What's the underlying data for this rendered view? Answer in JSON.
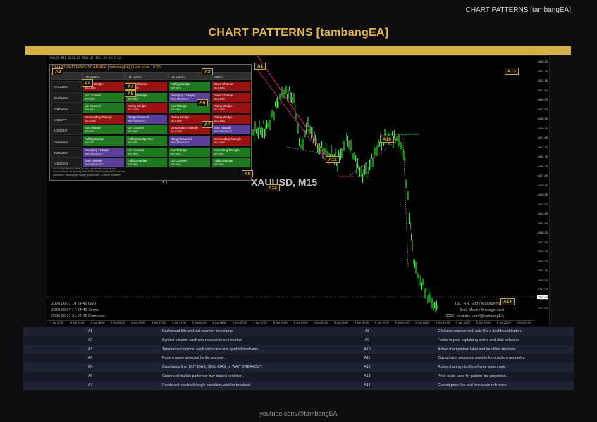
{
  "brand_top": "CHART PATTERNS [tambangEA]",
  "page_title": "CHART PATTERNS [tambangEA]",
  "plot_info": "XAUUSD,M15  4524.29 4530.41 4521.84 4527.03",
  "watermark": "XAUUSD, M15",
  "timestamps": [
    "2026.06.07 14:24:46 GMT",
    "2026.06.07 17:24:48 Server",
    "2026.06.07 21:24:46 Computer"
  ],
  "brand_box": [
    "1SL, RR, Entry Management",
    "2nd, Money Management",
    "2026, youtube.com/@tambangEA"
  ],
  "price_axis": [
    "4540.25",
    "4531.70",
    "4523.15",
    "4514.60",
    "4506.05",
    "4497.50",
    "4488.95",
    "4480.40",
    "4471.85",
    "4463.30",
    "4454.75",
    "4446.20",
    "4437.65",
    "4429.10",
    "4420.55",
    "4412.00",
    "4403.45",
    "4394.90",
    "4386.35",
    "4377.80",
    "4369.25",
    "4360.70",
    "4352.15",
    "4343.60",
    "4335.05",
    "4326.50",
    "4317.95"
  ],
  "current_price": "4327.04",
  "time_axis": [
    "4 Jun 2026",
    "4 Jun 04:00",
    "4 Jun 06:00",
    "4 Jun 08:00",
    "4 Jun 10:00",
    "4 Jun 12:00",
    "4 Jun 14:00",
    "4 Jun 16:00",
    "4 Jun 18:00",
    "4 Jun 20:00",
    "4 Jun 22:00",
    "5 Jun 00:00",
    "5 Jun 02:00",
    "5 Jun 04:00",
    "5 Jun 06:00",
    "5 Jun 08:00",
    "5 Jun 10:00",
    "5 Jun 12:00",
    "5 Jun 14:00",
    "5 Jun 16:00",
    "5 Jun 18:00",
    "5 Jun 20:00",
    "5 Jun 22:00",
    "5 Jun 23:00"
  ],
  "chart_labels": {
    "channel_note": "Ascending Wedge [Last Active]",
    "zigzag_a": "Falling Wedge",
    "zigzag_b": "BUY BIAS"
  },
  "scanner": {
    "title": "CHART PATTERNS SCANNER [tambangEA] | Last scan 15:25",
    "columns": [
      "M5 pattern",
      "H1 pattern",
      "H4 pattern",
      "pattern"
    ],
    "rows": [
      {
        "symbol": "XAUUSD",
        "cells": [
          {
            "name": "Rising Wedge",
            "bias": "SELL BIAS",
            "color": "#9a1212"
          },
          {
            "name": "Down Channel",
            "bias": "SELL BIAS",
            "color": "#9a1212"
          },
          {
            "name": "Falling Wedge",
            "bias": "BUY BIAS",
            "color": "#1f7a1f"
          },
          {
            "name": "Down Channel",
            "bias": "SELL BIAS",
            "color": "#9a1212"
          }
        ]
      },
      {
        "symbol": "EURUSD",
        "cells": [
          {
            "name": "Up Channel",
            "bias": "BUY BIAS",
            "color": "#1f7a1f"
          },
          {
            "name": "Falling Wedge",
            "bias": "BUY BIAS",
            "color": "#1f7a1f"
          },
          {
            "name": "Diverging Triangle",
            "bias": "WAIT BREAKOUT",
            "color": "#5a3f9a"
          },
          {
            "name": "Down Channel",
            "bias": "SELL BIAS",
            "color": "#9a1212"
          }
        ]
      },
      {
        "symbol": "GBPUSD",
        "cells": [
          {
            "name": "Up Channel",
            "bias": "BUY BIAS",
            "color": "#1f7a1f"
          },
          {
            "name": "Rising Wedge",
            "bias": "SELL BIAS",
            "color": "#9a1212"
          },
          {
            "name": "Asc Triangle",
            "bias": "BUY BIAS",
            "color": "#1f7a1f"
          },
          {
            "name": "Rising Wedge",
            "bias": "SELL BIAS",
            "color": "#9a1212"
          }
        ]
      },
      {
        "symbol": "USDJPY",
        "cells": [
          {
            "name": "Descending Triangle",
            "bias": "SELL BIAS",
            "color": "#9a1212"
          },
          {
            "name": "Range Channel",
            "bias": "WAIT BREAKOUT",
            "color": "#5a3f9a"
          },
          {
            "name": "Rising Wedge",
            "bias": "SELL BIAS",
            "color": "#9a1212"
          },
          {
            "name": "Rising Wedge",
            "bias": "SELL BIAS",
            "color": "#9a1212"
          }
        ]
      },
      {
        "symbol": "USDCHF",
        "cells": [
          {
            "name": "Asc Triangle",
            "bias": "BUY BIAS",
            "color": "#1f7a1f"
          },
          {
            "name": "Up Channel",
            "bias": "BUY BIAS",
            "color": "#1f7a1f"
          },
          {
            "name": "Descending Triangle",
            "bias": "SELL BIAS",
            "color": "#9a1212"
          },
          {
            "name": "Sym Triangle",
            "bias": "WAIT BREAKOUT",
            "color": "#5a3f9a"
          }
        ]
      },
      {
        "symbol": "AUDUSD",
        "cells": [
          {
            "name": "Falling Wedge",
            "bias": "BUY BIAS",
            "color": "#1f7a1f"
          },
          {
            "name": "Falling Wedge Rep",
            "bias": "BUY BIAS",
            "color": "#1f7a1f"
          },
          {
            "name": "Range Channel",
            "bias": "WAIT BREAKOUT",
            "color": "#5a3f9a"
          },
          {
            "name": "Descending Triangle",
            "bias": "SELL BIAS",
            "color": "#9a1212"
          }
        ]
      },
      {
        "symbol": "NZDUSD",
        "cells": [
          {
            "name": "Diverging Triangle",
            "bias": "WAIT BREAKOUT",
            "color": "#5a3f9a"
          },
          {
            "name": "Up Channel",
            "bias": "BUY BIAS",
            "color": "#1f7a1f"
          },
          {
            "name": "Asc Triangle",
            "bias": "BUY BIAS",
            "color": "#1f7a1f"
          },
          {
            "name": "Ascending Triangle",
            "bias": "BUY BIAS",
            "color": "#1f7a1f"
          }
        ]
      },
      {
        "symbol": "USDCAD",
        "cells": [
          {
            "name": "Sym Triangle",
            "bias": "WAIT BREAKOUT",
            "color": "#5a3f9a"
          },
          {
            "name": "Falling Wedge",
            "bias": "BUY BIAS",
            "color": "#1f7a1f"
          },
          {
            "name": "Up Channel",
            "bias": "BUY BIAS",
            "color": "#1f7a1f"
          },
          {
            "name": "Falling Wedge",
            "bias": "BUY BIAS",
            "color": "#1f7a1f"
          }
        ]
      }
    ],
    "footer": [
      "Cell format: pattern name on top, signal/bias below it/bias",
      "Colors: Green=BUY bias | Red=SELL bias | Purple=WAIT / neutral",
      "Click cell = switch/open chart | Bold border = current market/tf"
    ]
  },
  "callouts": [
    "A1",
    "A2",
    "A3",
    "A4",
    "A5",
    "A6",
    "A7",
    "A8",
    "A9",
    "A10",
    "A11",
    "A12",
    "A13",
    "A14"
  ],
  "legend": [
    {
      "left_key": "A1",
      "left_desc": "Dashboard title and last scanner timestamp.",
      "right_key": "A8",
      "right_desc": "Clickable scanner cell, acts like a dashboard button."
    },
    {
      "left_key": "A2",
      "left_desc": "Symbol column: each row represents one market.",
      "right_key": "A9",
      "right_desc": "Footer legend explaining colors and click behavior."
    },
    {
      "left_key": "A3",
      "left_desc": "Timeframe columns: each cell scans one symbol/timeframe.",
      "right_key": "A10",
      "right_desc": "Active chart pattern label and trendline structure."
    },
    {
      "left_key": "A4",
      "left_desc": "Pattern name detected by the scanner.",
      "right_key": "A11",
      "right_desc": "Zigzag/pivot sequence used to form pattern geometry."
    },
    {
      "left_key": "A5",
      "left_desc": "Bias/status line: BUY BIAS, SELL BIAS, or WAIT BREAKOUT.",
      "right_key": "A12",
      "right_desc": "Active chart symbol/timeframe watermark."
    },
    {
      "left_key": "A6",
      "left_desc": "Green cell: bullish pattern or buy-biased condition.",
      "right_key": "A13",
      "right_desc": "Price scale used for pattern line projection."
    },
    {
      "left_key": "A7",
      "left_desc": "Purple cell: neutral/triangle condition; wait for breakout.",
      "right_key": "A14",
      "right_desc": "Current price line and time scale reference."
    }
  ],
  "footer": "youtube.com/@tambangEA",
  "colors": {
    "accent": "#d4b048",
    "bull": "#1f7a1f",
    "bear": "#9a1212",
    "neutral": "#5a3f9a",
    "candle": "#3ee03e"
  }
}
